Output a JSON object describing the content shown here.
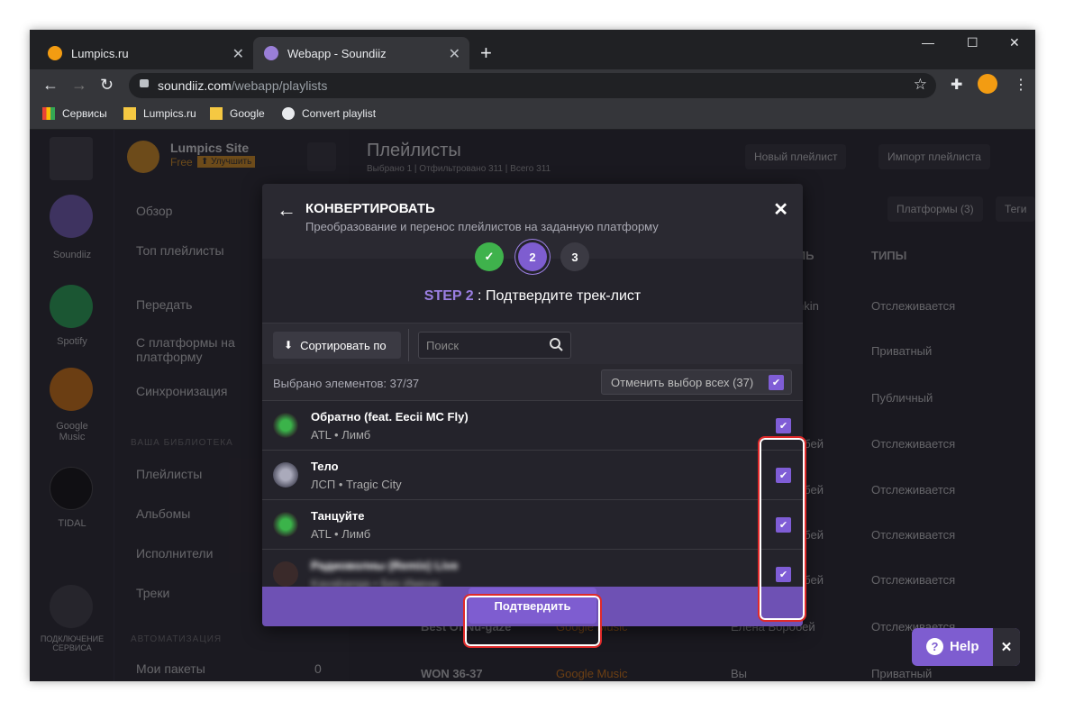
{
  "browser": {
    "tabs": [
      {
        "title": "Lumpics.ru",
        "favicon": "orange-circle-icon"
      },
      {
        "title": "Webapp - Soundiiz",
        "favicon": "soundiiz-icon"
      }
    ],
    "url_host": "soundiiz.com",
    "url_path": "/webapp/playlists",
    "bookmarks": [
      "Сервисы",
      "Lumpics.ru",
      "Google",
      "Convert playlist"
    ]
  },
  "app": {
    "user_name": "Lumpics Site",
    "plan": "Free",
    "upgrade": "⬆ Улучшить",
    "rail": [
      {
        "label": "Soundiiz"
      },
      {
        "label": "Spotify"
      },
      {
        "label": "Google Music"
      },
      {
        "label": "TIDAL"
      },
      {
        "label": "ПОДКЛЮЧЕНИЕ СЕРВИСА"
      }
    ],
    "nav": {
      "overview": "Обзор",
      "top": "Топ плейлисты",
      "transfer": "Передать",
      "p2p": "С платформы на платформу",
      "sync": "Синхронизация",
      "library_section": "ВАША БИБЛИОТЕКА",
      "playlists": "Плейлисты",
      "albums": "Альбомы",
      "artists": "Исполнители",
      "tracks": "Треки",
      "automation_section": "АВТОМАТИЗАЦИЯ",
      "packages": "Мои пакеты",
      "packages_count": "0"
    },
    "main": {
      "title": "Плейлисты",
      "subtitle": "Выбрано 1 | Отфильтровано 311 | Всего 311",
      "new_playlist": "Новый плейлист",
      "import_playlist": "Импорт плейлиста",
      "platforms": "Платформы (3)",
      "tags": "Теги",
      "col_types": "ТИПЫ",
      "col_owner_tail": "ЛЬ",
      "rows": [
        {
          "owner": "hkin",
          "type": "Отслеживается"
        },
        {
          "owner": "",
          "type": "Приватный"
        },
        {
          "owner": "",
          "type": "Публичный"
        },
        {
          "owner": "обей",
          "type": "Отслеживается"
        },
        {
          "owner": "обей",
          "type": "Отслеживается"
        },
        {
          "owner": "обей",
          "type": "Отслеживается"
        },
        {
          "owner": "обей",
          "type": "Отслеживается"
        },
        {
          "name": "Best Of Nu-gaze",
          "platform": "Google Music",
          "owner": "Елена Воробей",
          "type": "Отслеживается"
        },
        {
          "name": "WON 36-37",
          "platform": "Google Music",
          "owner": "Вы",
          "type": "Приватный"
        }
      ]
    }
  },
  "modal": {
    "title": "КОНВЕРТИРОВАТЬ",
    "subtitle": "Преобразование и перенос плейлистов на заданную платформу",
    "steps": [
      "✓",
      "2",
      "3"
    ],
    "step_label": "STEP 2",
    "step_sep": " : ",
    "step_text": "Подтвердите трек-лист",
    "sort_label": "Сортировать по",
    "search_placeholder": "Поиск",
    "selected_text": "Выбрано элементов: 37/37",
    "unselect_all": "Отменить выбор всех (37)",
    "tracks": [
      {
        "title": "Обратно (feat. Eecii MC Fly)",
        "artist": "ATL",
        "album": "Лимб",
        "checked": true
      },
      {
        "title": "Тело",
        "artist": "ЛСП",
        "album": "Tragic City",
        "checked": true
      },
      {
        "title": "Танцуйте",
        "artist": "ATL",
        "album": "Лимб",
        "checked": true
      },
      {
        "title": "Радиоволны (Remix) Live",
        "artist": "Kavabanga",
        "album": "Без Имени",
        "checked": true
      }
    ],
    "confirm": "Подтвердить"
  },
  "help": {
    "label": "Help"
  },
  "colors": {
    "accent": "#7e5dd0",
    "success": "#3fb24c",
    "annotation": "#e02a2a"
  }
}
